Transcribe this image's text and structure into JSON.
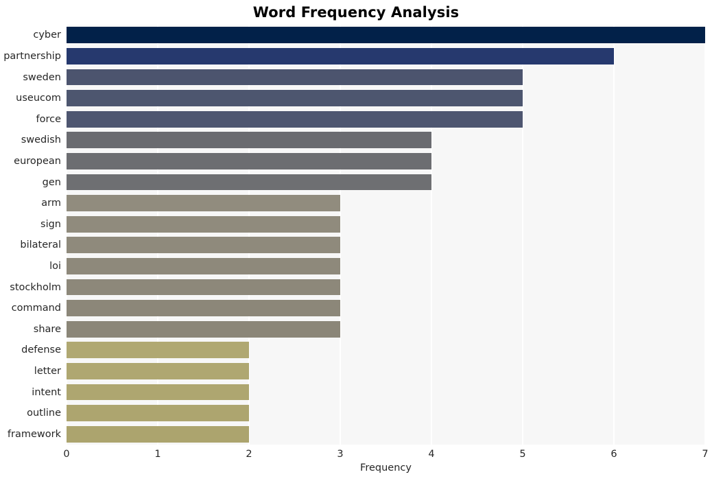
{
  "chart_data": {
    "type": "bar",
    "orientation": "horizontal",
    "title": "Word Frequency Analysis",
    "xlabel": "Frequency",
    "ylabel": "",
    "categories": [
      "cyber",
      "partnership",
      "sweden",
      "useucom",
      "force",
      "swedish",
      "european",
      "gen",
      "arm",
      "sign",
      "bilateral",
      "loi",
      "stockholm",
      "command",
      "share",
      "defense",
      "letter",
      "intent",
      "outline",
      "framework"
    ],
    "values": [
      7,
      6,
      5,
      5,
      5,
      4,
      4,
      4,
      3,
      3,
      3,
      3,
      3,
      3,
      3,
      2,
      2,
      2,
      2,
      2
    ],
    "bar_colors": [
      "#022149",
      "#26396e",
      "#4c546e",
      "#4d566f",
      "#4e5670",
      "#6a6b70",
      "#6c6d71",
      "#6e6f72",
      "#918c7e",
      "#908b7d",
      "#8f8a7c",
      "#8e897b",
      "#8d887a",
      "#8c8779",
      "#8b8678",
      "#b0a872",
      "#afa771",
      "#aea670",
      "#ada56f",
      "#aca46e"
    ],
    "xlim": [
      0,
      7
    ],
    "xticks": [
      0,
      1,
      2,
      3,
      4,
      5,
      6,
      7
    ],
    "xtick_labels": [
      "0",
      "1",
      "2",
      "3",
      "4",
      "5",
      "6",
      "7"
    ],
    "grid": true,
    "grid_axis": "x",
    "grid_color": "#ffffff",
    "plot_background": "#f7f7f7",
    "figure_background": "#ffffff",
    "legend": false,
    "legend_position": "none"
  }
}
